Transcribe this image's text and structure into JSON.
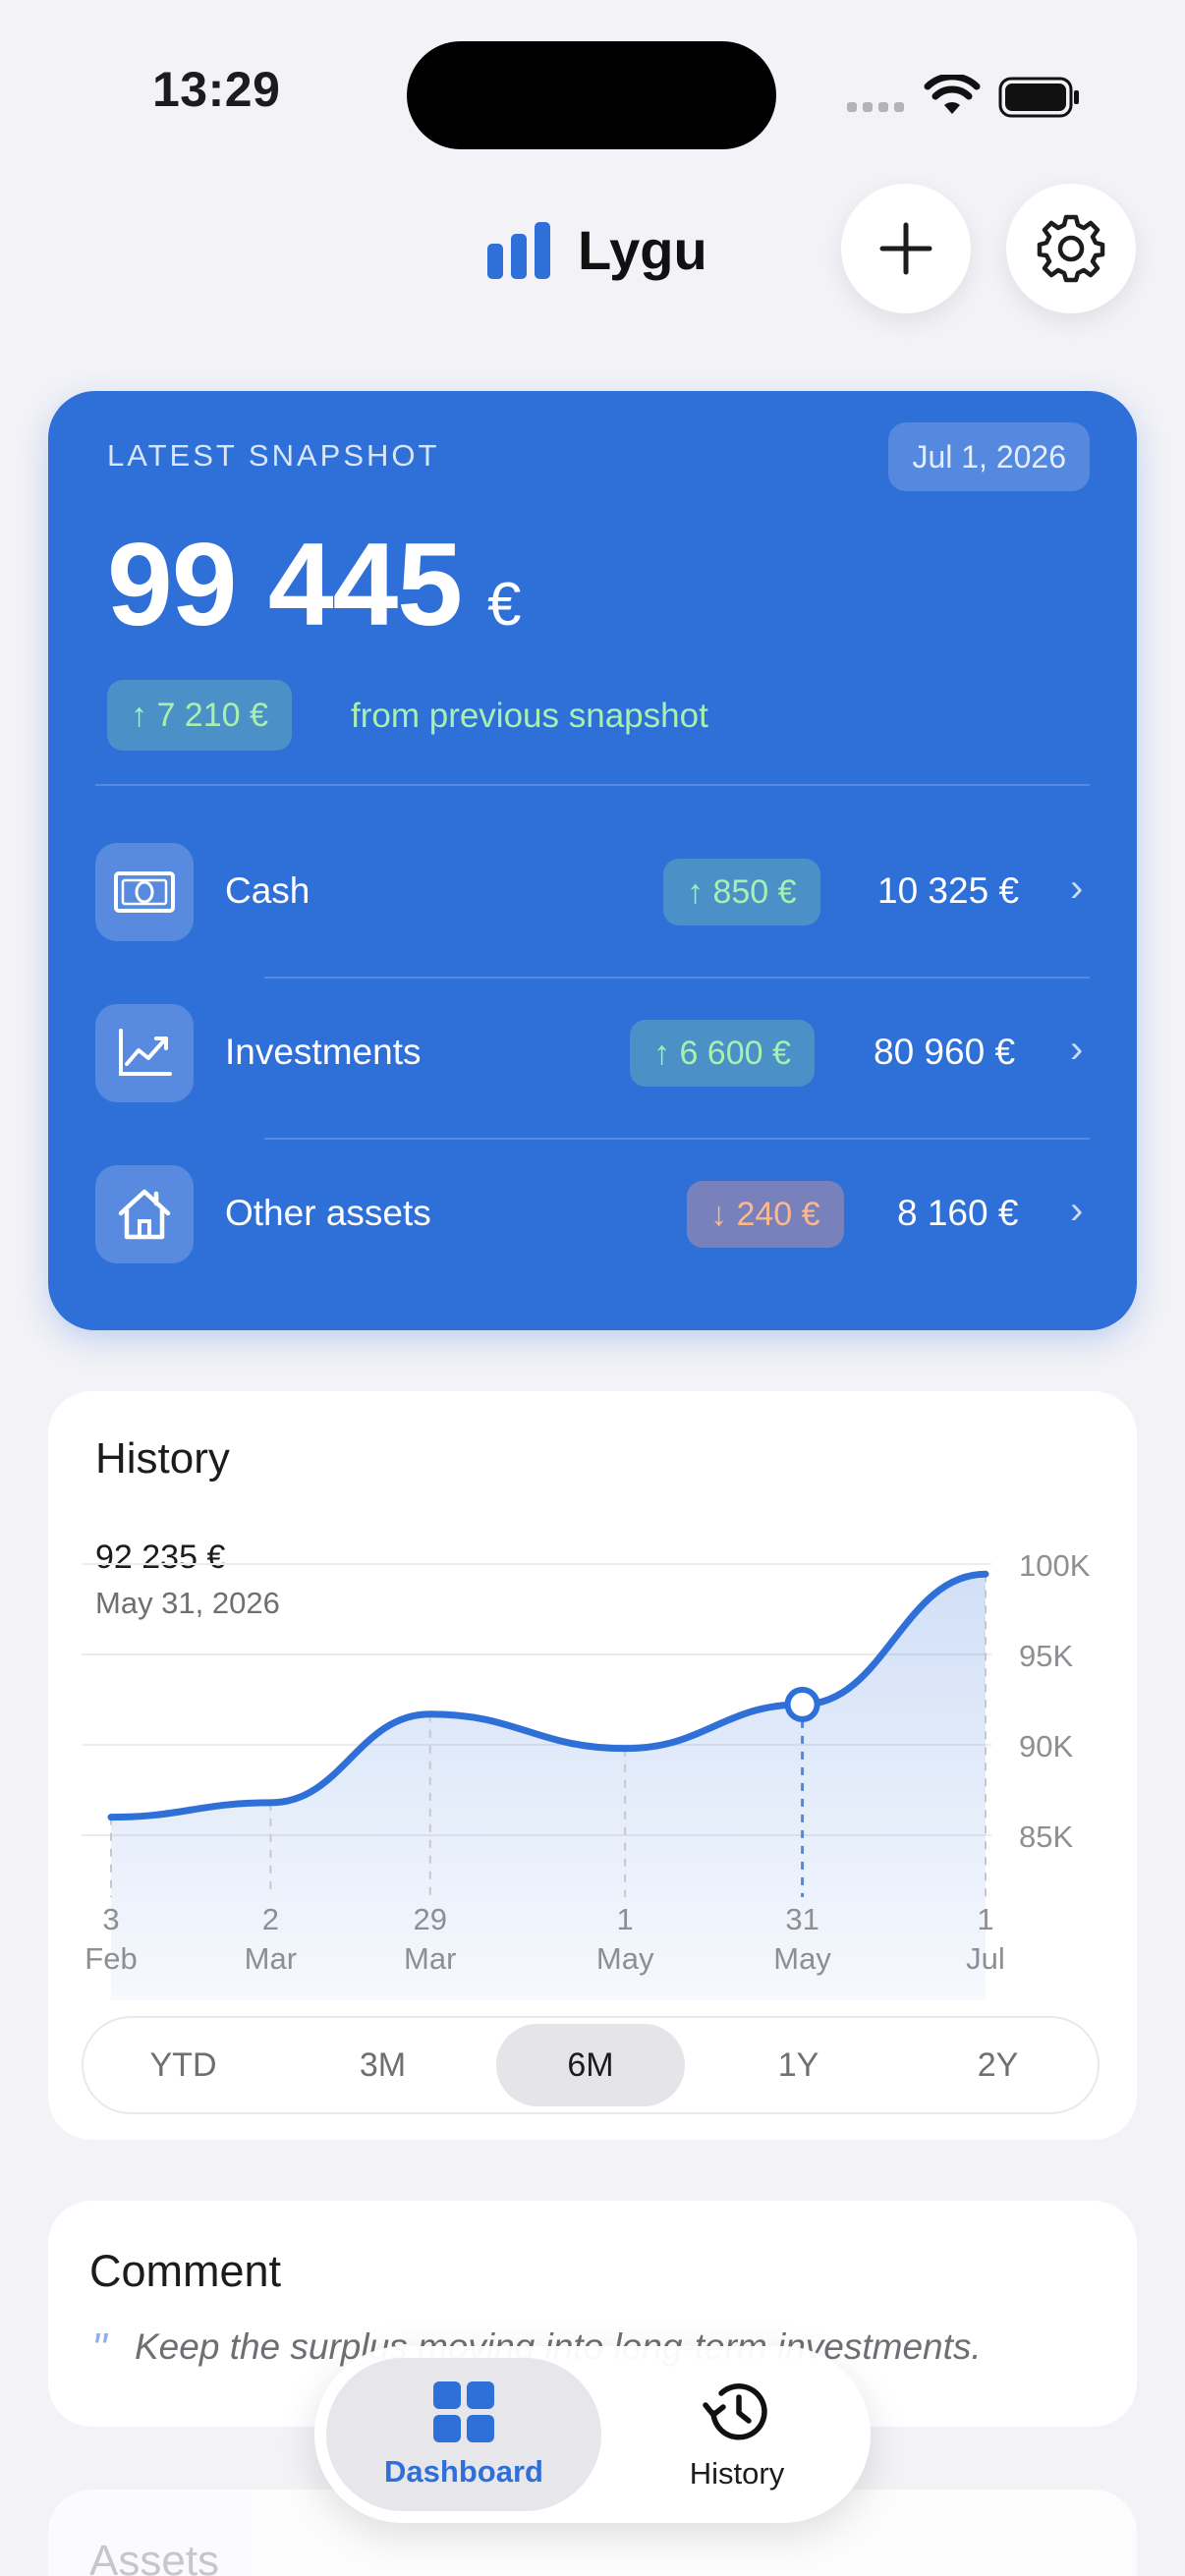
{
  "status_bar": {
    "time": "13:29"
  },
  "header": {
    "title": "Lygu",
    "logo_icon": "bar-chart-icon",
    "add_icon": "plus-icon",
    "settings_icon": "gear-icon"
  },
  "snapshot": {
    "label": "LATEST SNAPSHOT",
    "date": "Jul 1, 2026",
    "total": "99 445",
    "currency": "€",
    "delta": "↑ 7 210 €",
    "delta_text": "from previous snapshot",
    "rows": [
      {
        "label": "Cash",
        "icon": "cash-icon",
        "delta": "↑ 850 €",
        "value": "10 325 €",
        "direction": "up"
      },
      {
        "label": "Investments",
        "icon": "trend-chart-icon",
        "delta": "↑ 6 600 €",
        "value": "80 960 €",
        "direction": "up"
      },
      {
        "label": "Other assets",
        "icon": "home-icon",
        "delta": "↓ 240 €",
        "value": "8 160 €",
        "direction": "down"
      }
    ]
  },
  "history": {
    "title": "History",
    "selected_value": "92 235 €",
    "selected_date": "May 31, 2026",
    "ranges": [
      "YTD",
      "3M",
      "6M",
      "1Y",
      "2Y"
    ],
    "active_range": "6M"
  },
  "chart_data": {
    "type": "line",
    "x_labels": [
      [
        "3",
        "Feb"
      ],
      [
        "2",
        "Mar"
      ],
      [
        "29",
        "Mar"
      ],
      [
        "1",
        "May"
      ],
      [
        "31",
        "May"
      ],
      [
        "1",
        "Jul"
      ]
    ],
    "x": [
      "2026-02-03",
      "2026-03-02",
      "2026-03-29",
      "2026-05-01",
      "2026-05-31",
      "2026-07-01"
    ],
    "values": [
      86000,
      86800,
      91700,
      89800,
      92235,
      99445
    ],
    "y_ticks": [
      "100K",
      "95K",
      "90K",
      "85K"
    ],
    "ylim": [
      82000,
      100000
    ],
    "selected_index": 4,
    "color": "#2f6fd8"
  },
  "comment": {
    "title": "Comment",
    "quote_mark": "\"",
    "text": "Keep the surplus moving into long-term investments."
  },
  "assets": {
    "title": "Assets"
  },
  "tabbar": {
    "tabs": [
      {
        "label": "Dashboard",
        "icon": "grid-icon"
      },
      {
        "label": "History",
        "icon": "history-icon"
      }
    ]
  },
  "colors": {
    "accent": "#2f6fd8",
    "background": "#f2f2f7",
    "up": "#a8f0b0",
    "down": "#ffb88a"
  }
}
